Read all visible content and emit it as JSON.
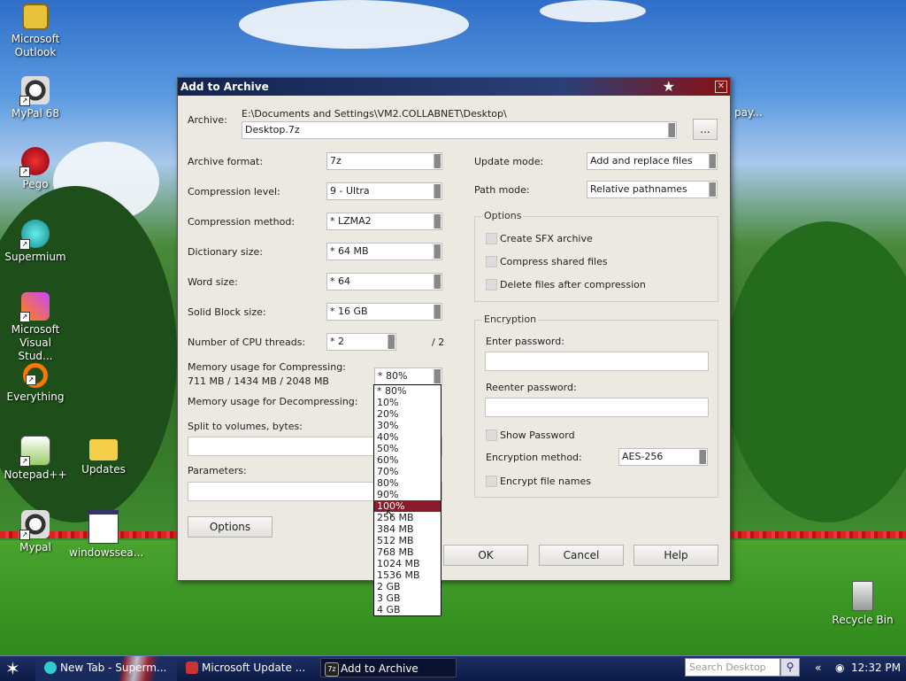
{
  "desktop": {
    "icons": [
      {
        "label": "Microsoft Outlook"
      },
      {
        "label": "MyPal 68"
      },
      {
        "label": "Pego"
      },
      {
        "label": "Supermium"
      },
      {
        "label": "Microsoft Visual Stud..."
      },
      {
        "label": "Everything"
      },
      {
        "label": "Notepad++"
      },
      {
        "label": "Updates"
      },
      {
        "label": "Mypal"
      },
      {
        "label": "windowssea..."
      },
      {
        "label": "Recycle Bin"
      }
    ],
    "bg_window_fragment": "pay..."
  },
  "dialog": {
    "title": "Add to Archive",
    "archive_label": "Archive:",
    "archive_path": "E:\\Documents and Settings\\VM2.COLLABNET\\Desktop\\",
    "archive_name": "Desktop.7z",
    "browse_label": "...",
    "left": {
      "format_label": "Archive format:",
      "format_value": "7z",
      "level_label": "Compression level:",
      "level_value": "9 - Ultra",
      "method_label": "Compression method:",
      "method_value": "* LZMA2",
      "dict_label": "Dictionary size:",
      "dict_value": "* 64 MB",
      "word_label": "Word size:",
      "word_value": "* 64",
      "solid_label": "Solid Block size:",
      "solid_value": "* 16 GB",
      "threads_label": "Number of CPU threads:",
      "threads_value": "* 2",
      "threads_max": "/ 2",
      "mem_comp_label": "Memory usage for Compressing:",
      "mem_comp_detail": "711 MB / 1434 MB / 2048 MB",
      "mem_comp_value": "* 80%",
      "mem_decomp_label": "Memory usage for Decompressing:",
      "split_label": "Split to volumes, bytes:",
      "params_label": "Parameters:",
      "options_button": "Options"
    },
    "right": {
      "update_label": "Update mode:",
      "update_value": "Add and replace files",
      "path_label": "Path mode:",
      "path_value": "Relative pathnames",
      "options_group": "Options",
      "opt_sfx": "Create SFX archive",
      "opt_shared": "Compress shared files",
      "opt_delete": "Delete files after compression",
      "enc_group": "Encryption",
      "enter_pw": "Enter password:",
      "reenter_pw": "Reenter password:",
      "show_pw": "Show Password",
      "enc_method_label": "Encryption method:",
      "enc_method_value": "AES-256",
      "enc_names": "Encrypt file names"
    },
    "buttons": {
      "ok": "OK",
      "cancel": "Cancel",
      "help": "Help"
    },
    "dropdown": {
      "items": [
        "* 80%",
        "10%",
        "20%",
        "30%",
        "40%",
        "50%",
        "60%",
        "70%",
        "80%",
        "90%",
        "100%",
        "256 MB",
        "384 MB",
        "512 MB",
        "768 MB",
        "1024 MB",
        "1536 MB",
        "2 GB",
        "3 GB",
        "4 GB"
      ],
      "selected_index": 10
    }
  },
  "taskbar": {
    "tasks": [
      "New Tab - Superm...",
      "Microsoft Update ...",
      "Add to Archive"
    ],
    "search_placeholder": "Search Desktop",
    "clock": "12:32 PM",
    "tray_chevron": "«"
  }
}
